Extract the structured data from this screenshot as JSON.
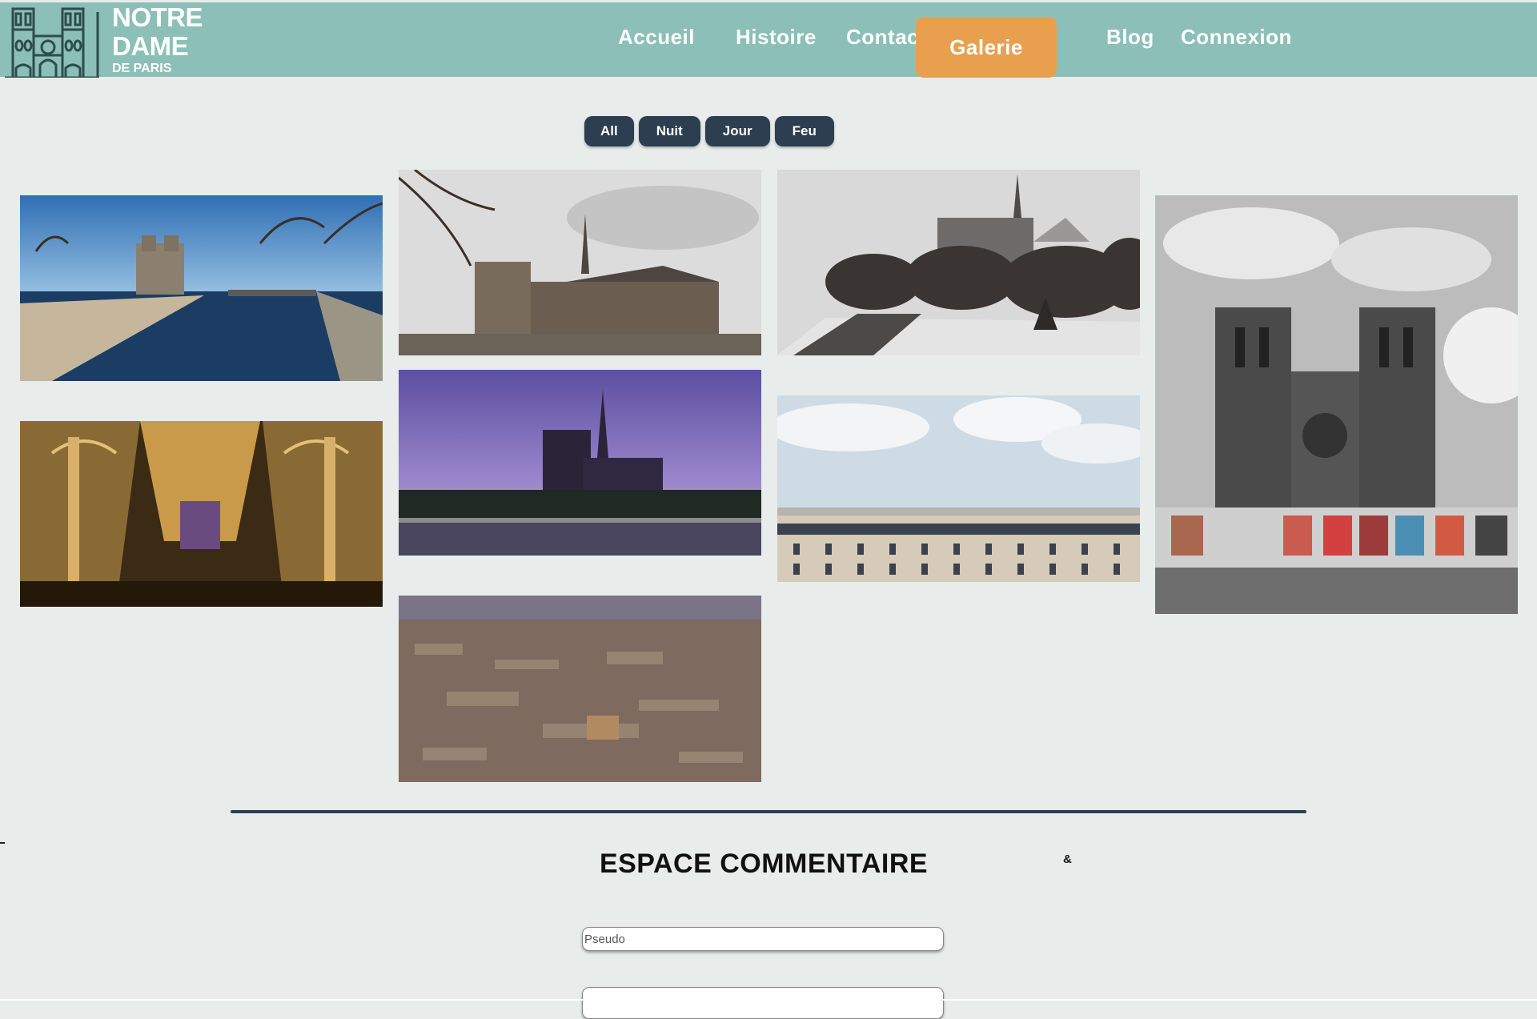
{
  "header": {
    "logo": {
      "line1": "NOTRE",
      "line2": "DAME",
      "line3": "DE PARIS",
      "icon": "cathedral-icon"
    },
    "nav": [
      {
        "label": "Accueil",
        "active": false
      },
      {
        "label": "Histoire",
        "active": false
      },
      {
        "label": "Contact",
        "active": false
      },
      {
        "label": "Galerie",
        "active": true
      },
      {
        "label": "Blog",
        "active": false
      },
      {
        "label": "Connexion",
        "active": false
      }
    ]
  },
  "filters": [
    "All",
    "Nuit",
    "Jour",
    "Feu"
  ],
  "gallery": [
    {
      "subject": "seine-river-view"
    },
    {
      "subject": "cathedral-interior-nave"
    },
    {
      "subject": "cathedral-side-cloudy"
    },
    {
      "subject": "cathedral-sunset-purple"
    },
    {
      "subject": "paris-aerial-dusk"
    },
    {
      "subject": "cathedral-winter-garden"
    },
    {
      "subject": "paris-rooftops"
    },
    {
      "subject": "cathedral-facade-bw"
    }
  ],
  "comments": {
    "title": "ESPACE COMMENTAIRE",
    "symbol": "&",
    "pseudo_placeholder": "Pseudo"
  },
  "colors": {
    "header_bg": "#8bbfb8",
    "active_nav": "#e8a04e",
    "button_bg": "#2c3e50",
    "page_bg": "#e8eceb"
  }
}
